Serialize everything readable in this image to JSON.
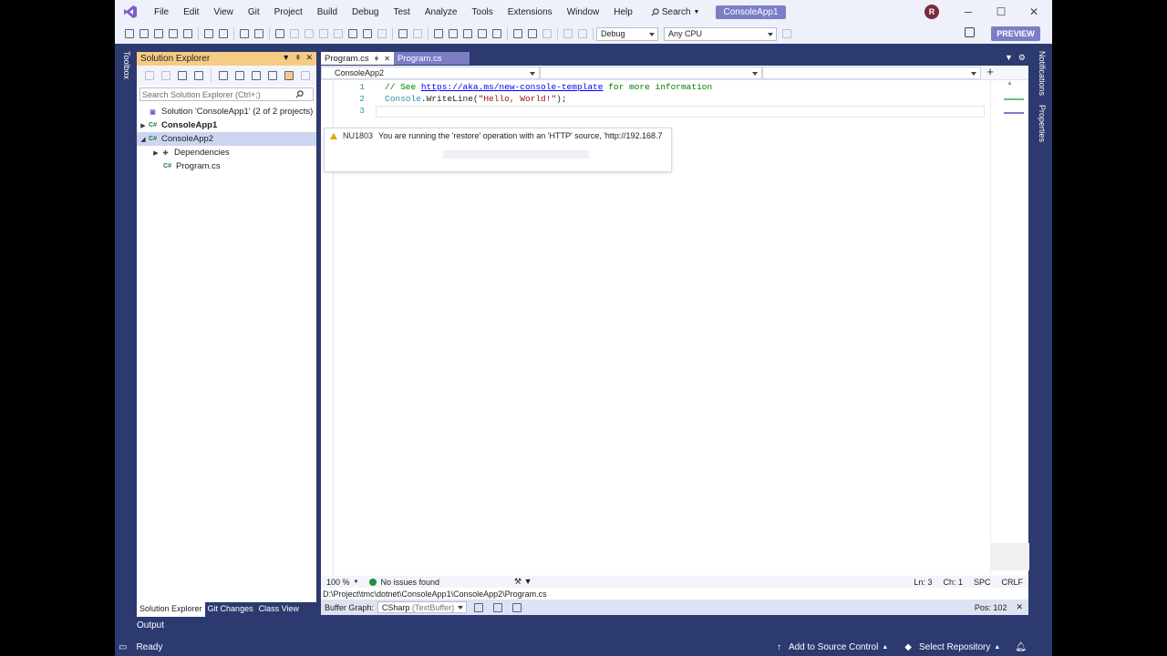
{
  "app": {
    "title": "ConsoleApp1",
    "avatar_initial": "R",
    "menu": [
      "File",
      "Edit",
      "View",
      "Git",
      "Project",
      "Build",
      "Debug",
      "Test",
      "Analyze",
      "Tools",
      "Extensions",
      "Window",
      "Help"
    ],
    "search_label": "Search",
    "accent_color": "#7b7ec5"
  },
  "toolbar": {
    "config": "Debug",
    "platform": "Any CPU",
    "preview_label": "PREVIEW"
  },
  "toolbox_label": "Toolbox",
  "solution_explorer": {
    "title": "Solution Explorer",
    "search_placeholder": "Search Solution Explorer (Ctrl+;)",
    "items": [
      {
        "label": "Solution 'ConsoleApp1' (2 of 2 projects)"
      },
      {
        "label": "ConsoleApp1"
      },
      {
        "label": "ConsoleApp2"
      },
      {
        "label": "Dependencies"
      },
      {
        "label": "Program.cs"
      }
    ],
    "tabs": [
      "Solution Explorer",
      "Git Changes",
      "Class View"
    ]
  },
  "output_label": "Output",
  "editor": {
    "tabs": [
      {
        "label": "Program.cs"
      },
      {
        "label": "Program.cs"
      }
    ],
    "nav_project": "ConsoleApp2",
    "lines": [
      {
        "num": "1",
        "comment": "// See ",
        "link": "https://aka.ms/new-console-template",
        "rest": " for more information"
      },
      {
        "num": "2",
        "type": "Console",
        "method": ".WriteLine(",
        "str": "\"Hello, World!\"",
        "end": ");"
      },
      {
        "num": "3"
      }
    ],
    "tooltip": {
      "code": "NU1803",
      "message": "You are running the 'restore' operation with an 'HTTP' source, 'http://192.168.7"
    },
    "status": {
      "zoom": "100 %",
      "issues": "No issues found",
      "ln": "Ln: 3",
      "ch": "Ch: 1",
      "spc": "SPC",
      "crlf": "CRLF"
    },
    "path": "D:\\Project\\tmc\\dotnet\\ConsoleApp1\\ConsoleApp2\\Program.cs",
    "buffer": {
      "label": "Buffer Graph:",
      "value": "CSharp",
      "value_hint": "(TextBuffer)",
      "pos": "Pos: 102"
    }
  },
  "right_strip": [
    "Notifications",
    "Properties"
  ],
  "statusbar": {
    "ready": "Ready",
    "add_source": "Add to Source Control",
    "select_repo": "Select Repository"
  }
}
